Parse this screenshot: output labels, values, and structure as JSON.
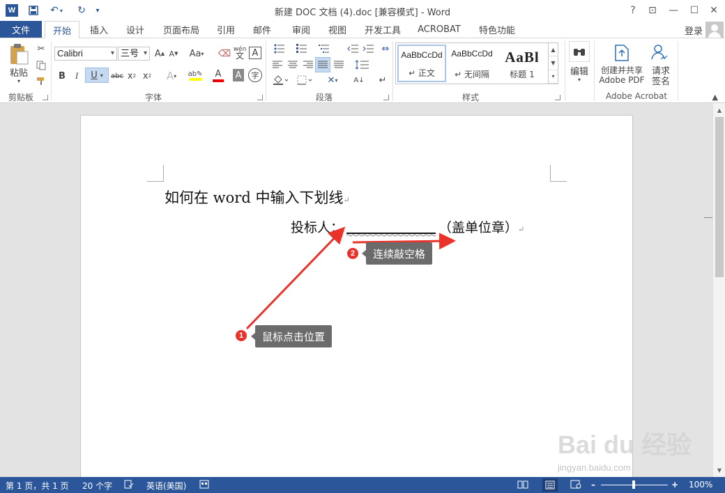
{
  "titlebar": {
    "app_logo": "W",
    "title": "新建 DOC 文档 (4).doc [兼容模式] - Word",
    "help": "?",
    "ribbon_display": "⊡",
    "minimize": "—",
    "maximize": "☐",
    "close": "✕"
  },
  "tabs": {
    "file": "文件",
    "items": [
      "开始",
      "插入",
      "设计",
      "页面布局",
      "引用",
      "邮件",
      "审阅",
      "视图",
      "开发工具",
      "ACROBAT",
      "特色功能"
    ],
    "login": "登录"
  },
  "ribbon": {
    "clipboard": {
      "paste": "粘贴",
      "label": "剪贴板"
    },
    "font": {
      "font_name": "Calibri",
      "font_size": "三号",
      "grow": "A",
      "shrink": "A",
      "case": "Aa",
      "phonetic": "wén",
      "charborder": "A",
      "bold": "B",
      "italic": "I",
      "underline": "U",
      "strike": "abc",
      "sub": "x",
      "sup": "x",
      "effects": "A",
      "fontcolor": "A",
      "shading": "A",
      "enclose": "字",
      "label": "字体"
    },
    "paragraph": {
      "label": "段落"
    },
    "styles": {
      "items": [
        {
          "preview": "AaBbCcDd",
          "name": "↵ 正文"
        },
        {
          "preview": "AaBbCcDd",
          "name": "↵ 无间隔"
        },
        {
          "preview": "AaBl",
          "name": "标题 1"
        }
      ],
      "label": "样式"
    },
    "editing": {
      "label": "编辑"
    },
    "acrobat": {
      "create_pdf_line1": "创建并共享",
      "create_pdf_line2": "Adobe PDF",
      "sign_line1": "请求",
      "sign_line2": "签名",
      "label": "Adobe Acrobat"
    }
  },
  "document": {
    "line1": "如何在 word 中输入下划线",
    "line2_prefix": "投标人：",
    "line2_suffix": "（盖单位章）",
    "para_mark": "↵"
  },
  "annotations": [
    {
      "number": "1",
      "text": "鼠标点击位置"
    },
    {
      "number": "2",
      "text": "连续敲空格"
    }
  ],
  "watermark": {
    "main": "Bai du 经验",
    "sub": "jingyan.baidu.com"
  },
  "statusbar": {
    "page": "第 1 页，共 1 页",
    "words": "20 个字",
    "language": "英语(美国)",
    "zoom": "100%",
    "zoom_level": 1.0
  },
  "colors": {
    "accent": "#2b579a",
    "annotation_red": "#e8322a",
    "callout_bg": "#6b6b6b"
  }
}
